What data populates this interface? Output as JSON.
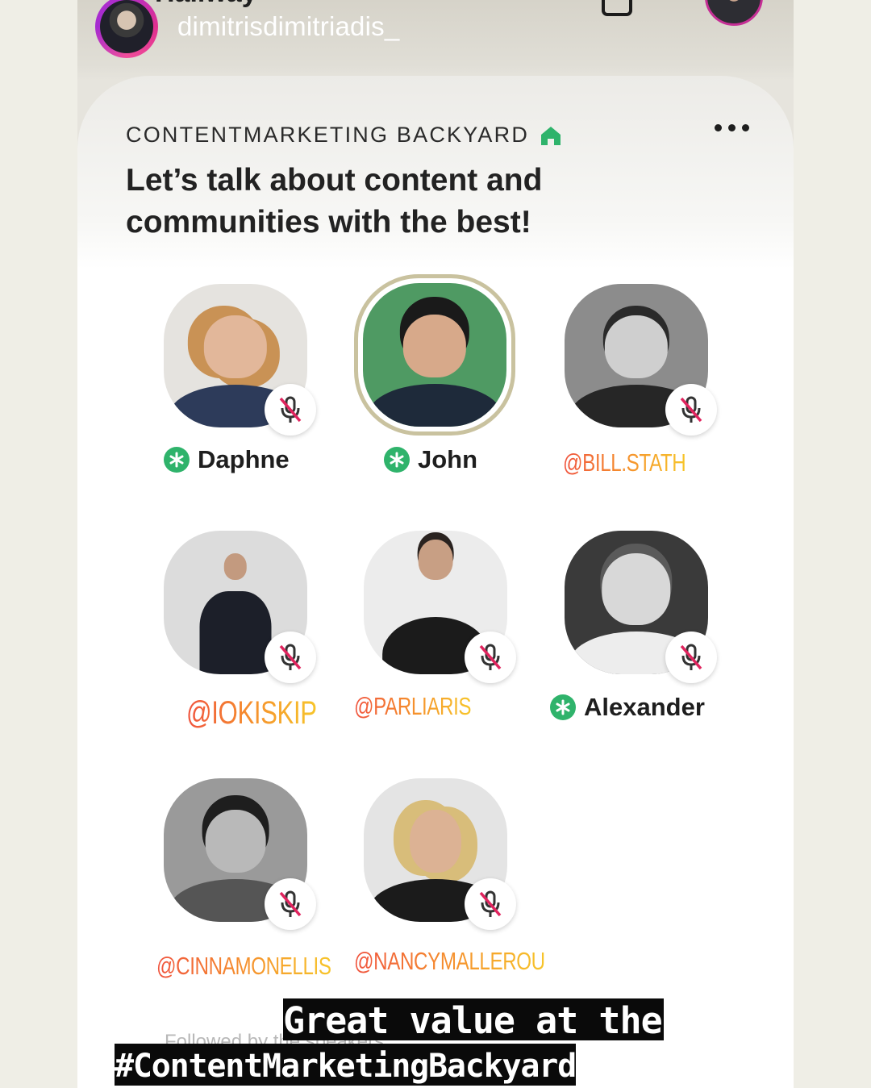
{
  "story": {
    "title_partial": "Hallway",
    "username": "dimitrisdimitriadis_"
  },
  "room": {
    "club_name": "CONTENTMARKETING BACKYARD",
    "title_line1": "Let’s talk about content and",
    "title_line2": "communities with the best!"
  },
  "speakers": [
    {
      "label": "Daphne",
      "type": "name",
      "new_member_badge": true,
      "muted": true
    },
    {
      "label": "John",
      "type": "name",
      "new_member_badge": true,
      "muted": false,
      "speaking_ring": true
    },
    {
      "label": "@BILL.STATH",
      "type": "handle",
      "muted": true
    },
    {
      "label": "@IOKISKIP",
      "type": "handle",
      "muted": true
    },
    {
      "label": "@PARLIARIS",
      "type": "handle",
      "muted": true
    },
    {
      "label": "Alexander",
      "type": "name",
      "new_member_badge": true,
      "muted": true
    },
    {
      "label": "@CINNAMONELLIS",
      "type": "handle",
      "muted": true
    },
    {
      "label": "@NANCYMALLEROU",
      "type": "handle",
      "muted": true
    }
  ],
  "footer": {
    "section_label": "Followed by the speakers",
    "caption_line1": "Great value at the",
    "caption_line2": "#ContentMarketingBackyard"
  },
  "icons": {
    "house": "house-icon",
    "more": "more-dots-icon",
    "mic_off": "mic-off-icon",
    "badge": "new-member-badge-icon"
  },
  "colors": {
    "house_green": "#2fb36b",
    "badge_green": "#2fb36b",
    "mic_red": "#e0245e",
    "handle_gradient_start": "#f0543f",
    "handle_gradient_end": "#f7c52a",
    "speaking_ring": "#c9c29f"
  }
}
